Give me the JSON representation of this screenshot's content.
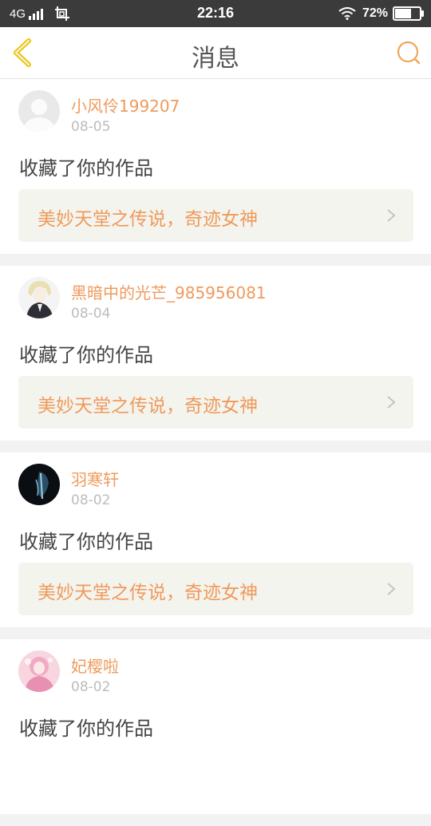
{
  "status_bar": {
    "network": "4G",
    "time": "22:16",
    "battery_percent": "72%",
    "battery_level": 0.72,
    "icons": [
      "signal-icon",
      "screenshot-icon",
      "wifi-icon",
      "battery-icon"
    ]
  },
  "header": {
    "title": "消息",
    "back_icon": "chevron-left-icon",
    "search_icon": "search-icon",
    "accent_color": "#f0a55a"
  },
  "messages": [
    {
      "user": "小风伶199207",
      "date": "08-05",
      "action": "收藏了你的作品",
      "work": "美妙天堂之传说，奇迹女神"
    },
    {
      "user": "黑暗中的光芒_985956081",
      "date": "08-04",
      "action": "收藏了你的作品",
      "work": "美妙天堂之传说，奇迹女神"
    },
    {
      "user": "羽寒轩",
      "date": "08-02",
      "action": "收藏了你的作品",
      "work": "美妙天堂之传说，奇迹女神"
    },
    {
      "user": "妃樱啦",
      "date": "08-02",
      "action": "收藏了你的作品",
      "work": ""
    }
  ],
  "colors": {
    "username": "#ef9a5c",
    "date": "#bcbcbc",
    "status_bar": "#3b3b3b",
    "card_link_bg": "#f4f4ee",
    "page_bg": "#f2f2f2"
  }
}
